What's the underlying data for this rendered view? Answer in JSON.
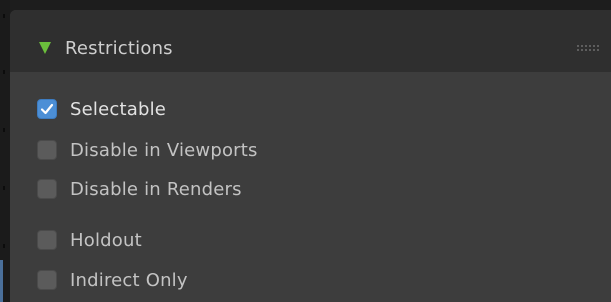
{
  "panel": {
    "title": "Restrictions",
    "expanded": true,
    "disclosure_icon": "triangle-down-icon",
    "drag_icon": "drag-handle-icon",
    "accent_color": "#6bbf3c"
  },
  "options": [
    {
      "label": "Selectable",
      "checked": true
    },
    {
      "label": "Disable in Viewports",
      "checked": false
    },
    {
      "label": "Disable in Renders",
      "checked": false
    },
    {
      "label": "Holdout",
      "checked": false
    },
    {
      "label": "Indirect Only",
      "checked": false
    }
  ],
  "colors": {
    "checked_box": "#4c8fd6",
    "unchecked_box": "#5b5b5b"
  }
}
